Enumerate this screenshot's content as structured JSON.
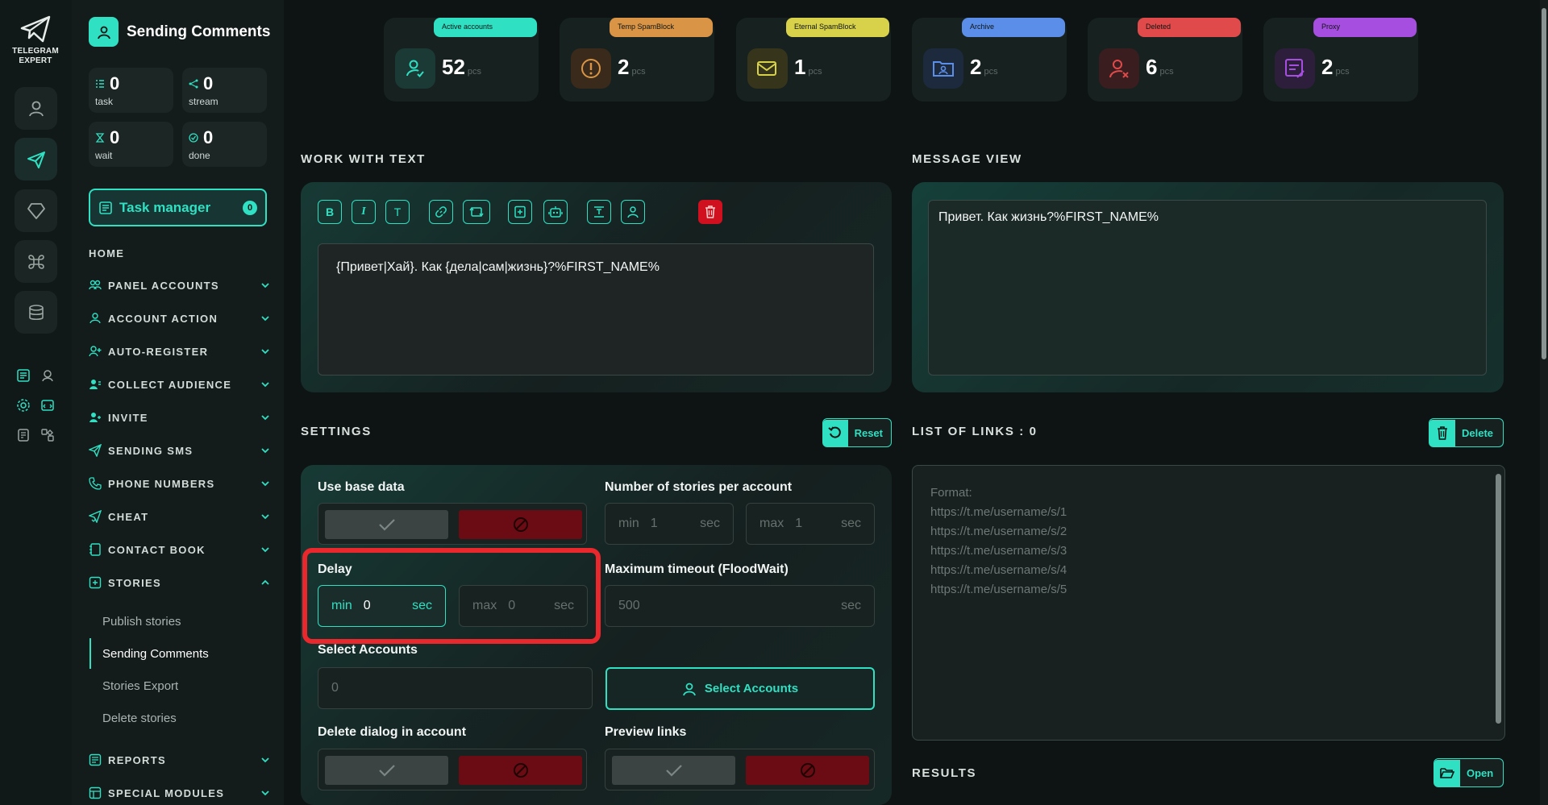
{
  "rail": {
    "logo_line1": "TELEGRAM",
    "logo_line2": "EXPERT"
  },
  "nav": {
    "title": "Sending Comments",
    "stats": [
      {
        "value": "0",
        "label": "task"
      },
      {
        "value": "0",
        "label": "stream"
      },
      {
        "value": "0",
        "label": "wait"
      },
      {
        "value": "0",
        "label": "done"
      }
    ],
    "task_manager": {
      "label": "Task manager",
      "count": "0"
    },
    "home": "HOME",
    "items": [
      "PANEL ACCOUNTS",
      "ACCOUNT ACTION",
      "AUTO-REGISTER",
      "COLLECT AUDIENCE",
      "INVITE",
      "SENDING SMS",
      "PHONE NUMBERS",
      "CHEAT",
      "CONTACT BOOK",
      "STORIES"
    ],
    "stories_sub": [
      "Publish stories",
      "Sending Comments",
      "Stories Export",
      "Delete stories"
    ],
    "bottom_items": [
      "REPORTS",
      "SPECIAL MODULES"
    ]
  },
  "cards": [
    {
      "tag": "Active accounts",
      "value": "52",
      "unit": "pcs",
      "color": "#2fe0c3"
    },
    {
      "tag": "Temp SpamBlock",
      "value": "2",
      "unit": "pcs",
      "color": "#d99545"
    },
    {
      "tag": "Eternal SpamBlock",
      "value": "1",
      "unit": "pcs",
      "color": "#d8d24a"
    },
    {
      "tag": "Archive",
      "value": "2",
      "unit": "pcs",
      "color": "#5b8ee8"
    },
    {
      "tag": "Deleted",
      "value": "6",
      "unit": "pcs",
      "color": "#e04a4a"
    },
    {
      "tag": "Proxy",
      "value": "2",
      "unit": "pcs",
      "color": "#a64ee0"
    }
  ],
  "work": {
    "title": "WORK WITH TEXT",
    "toolbar": {
      "bold": "B",
      "italic": "I",
      "text": "T"
    },
    "editor_text": "{Привет|Хай}. Как {дела|сам|жизнь}?%FIRST_NAME%"
  },
  "view": {
    "title": "MESSAGE VIEW",
    "text": "Привет. Как жизнь?%FIRST_NAME%"
  },
  "settings": {
    "title": "SETTINGS",
    "reset_label": "Reset",
    "use_base_data": "Use base data",
    "stories_per_account": "Number of stories per account",
    "stories_min": {
      "pre": "min",
      "value": "1",
      "suf": "sec"
    },
    "stories_max": {
      "pre": "max",
      "value": "1",
      "suf": "sec"
    },
    "delay": "Delay",
    "delay_min": {
      "pre": "min",
      "value": "0",
      "suf": "sec"
    },
    "delay_max": {
      "pre": "max",
      "value": "0",
      "suf": "sec"
    },
    "max_timeout": "Maximum timeout (FloodWait)",
    "timeout": {
      "value": "500",
      "suf": "sec"
    },
    "select_accounts": "Select Accounts",
    "select_accounts_value": "0",
    "select_accounts_btn": "Select Accounts",
    "delete_dialog": "Delete dialog in account",
    "preview_links": "Preview links"
  },
  "links": {
    "title": "LIST OF LINKS : 0",
    "delete_label": "Delete",
    "placeholder_lines": [
      "Format:",
      "https://t.me/username/s/1",
      "https://t.me/username/s/2",
      "https://t.me/username/s/3",
      "https://t.me/username/s/4",
      "https://t.me/username/s/5"
    ]
  },
  "results": {
    "title": "RESULTS",
    "open_label": "Open"
  }
}
